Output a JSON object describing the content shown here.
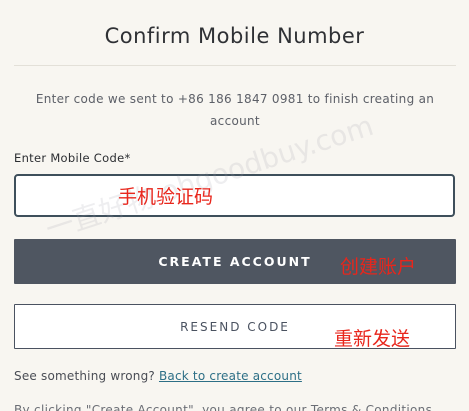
{
  "header": {
    "title": "Confirm Mobile Number"
  },
  "instruction": {
    "text": "Enter code we sent to +86 186 1847 0981 to finish creating an account"
  },
  "form": {
    "code_label": "Enter Mobile Code*",
    "code_value": "",
    "create_label": "CREATE ACCOUNT",
    "resend_label": "RESEND CODE"
  },
  "annotations": {
    "code": "手机验证码",
    "create": "创建账户",
    "resend": "重新发送"
  },
  "footer": {
    "prompt": "See something wrong? ",
    "link_text": "Back to create account"
  },
  "watermark": {
    "text": "一直好物 ohgoodbuy.com"
  },
  "truncated_line": {
    "text": "By clicking \"Create Account\", you agree to our Terms & Conditions"
  },
  "colors": {
    "background": "#f8f6f1",
    "primary_button": "#4f5661",
    "input_border": "#3e4f5b",
    "link": "#2d6f86",
    "annotation": "#e8261c"
  }
}
